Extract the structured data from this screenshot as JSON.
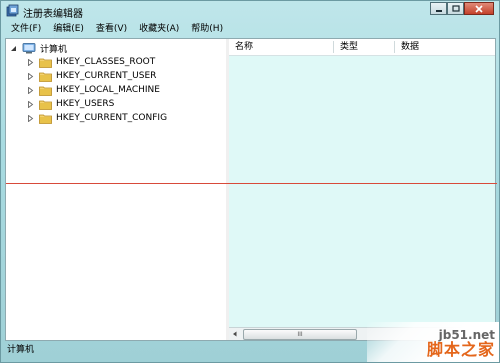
{
  "window": {
    "title": "注册表编辑器"
  },
  "menu": [
    {
      "label": "文件(F)"
    },
    {
      "label": "编辑(E)"
    },
    {
      "label": "查看(V)"
    },
    {
      "label": "收藏夹(A)"
    },
    {
      "label": "帮助(H)"
    }
  ],
  "tree": {
    "root": {
      "label": "计算机",
      "icon": "computer-icon"
    },
    "children": [
      {
        "label": "HKEY_CLASSES_ROOT",
        "icon": "folder-icon"
      },
      {
        "label": "HKEY_CURRENT_USER",
        "icon": "folder-icon"
      },
      {
        "label": "HKEY_LOCAL_MACHINE",
        "icon": "folder-icon"
      },
      {
        "label": "HKEY_USERS",
        "icon": "folder-icon"
      },
      {
        "label": "HKEY_CURRENT_CONFIG",
        "icon": "folder-icon"
      }
    ]
  },
  "list": {
    "columns": [
      {
        "label": "名称"
      },
      {
        "label": "类型"
      },
      {
        "label": "数据"
      }
    ],
    "scroll_thumb": "III"
  },
  "status": {
    "text": "计算机"
  },
  "watermark": {
    "site": "jb51.net",
    "name": "脚本之家"
  },
  "colors": {
    "window_frame": "#9fd0d6",
    "list_background": "#dff9f7",
    "annotation_line": "#d84a3a",
    "folder": "#e8c24a"
  }
}
